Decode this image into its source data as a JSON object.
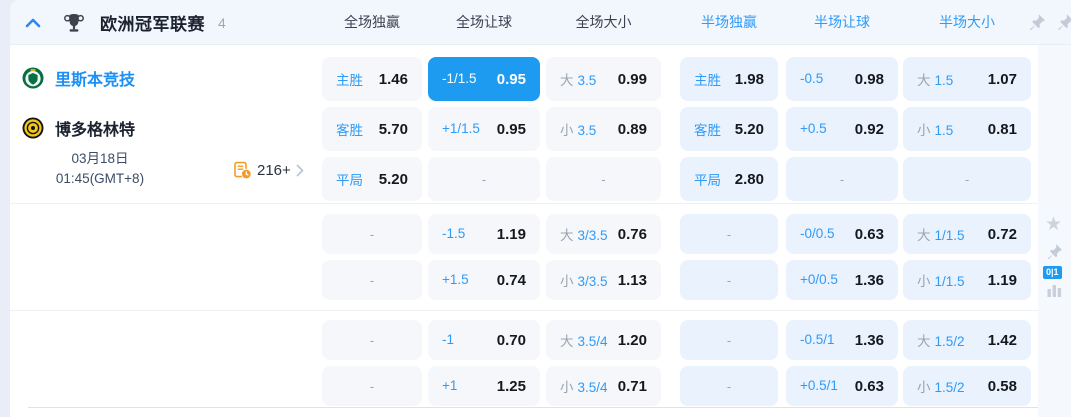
{
  "panel": {
    "league": "欧洲冠军联赛",
    "match_count": "4",
    "columns": [
      {
        "label": "全场独赢",
        "scope": "full"
      },
      {
        "label": "全场让球",
        "scope": "full"
      },
      {
        "label": "全场大小",
        "scope": "full"
      },
      {
        "label": "半场独赢",
        "scope": "half"
      },
      {
        "label": "半场让球",
        "scope": "half"
      },
      {
        "label": "半场大小",
        "scope": "half"
      }
    ]
  },
  "match": {
    "home_team": "里斯本竞技",
    "away_team": "博多格林特",
    "date": "03月18日",
    "time": "01:45(GMT+8)",
    "more_markets": "216+"
  },
  "odds_sections": [
    {
      "rows": [
        {
          "cells": [
            {
              "label": "主胜",
              "value": "1.46"
            },
            {
              "label": "-1/1.5",
              "value": "0.95",
              "selected": true
            },
            {
              "prefix": "大",
              "label": "3.5",
              "value": "0.99"
            },
            {
              "label": "主胜",
              "value": "1.98"
            },
            {
              "label": "-0.5",
              "value": "0.98"
            },
            {
              "prefix": "大",
              "label": "1.5",
              "value": "1.07"
            }
          ]
        },
        {
          "cells": [
            {
              "label": "客胜",
              "value": "5.70"
            },
            {
              "label": "+1/1.5",
              "value": "0.95"
            },
            {
              "prefix": "小",
              "label": "3.5",
              "value": "0.89"
            },
            {
              "label": "客胜",
              "value": "5.20"
            },
            {
              "label": "+0.5",
              "value": "0.92"
            },
            {
              "prefix": "小",
              "label": "1.5",
              "value": "0.81"
            }
          ]
        },
        {
          "cells": [
            {
              "label": "平局",
              "value": "5.20"
            },
            {
              "dash": "-"
            },
            {
              "dash": "-"
            },
            {
              "label": "平局",
              "value": "2.80"
            },
            {
              "dash": "-"
            },
            {
              "dash": "-"
            }
          ]
        }
      ]
    },
    {
      "rows": [
        {
          "cells": [
            {
              "dash": "-"
            },
            {
              "label": "-1.5",
              "value": "1.19"
            },
            {
              "prefix": "大",
              "label": "3/3.5",
              "value": "0.76"
            },
            {
              "dash": "-"
            },
            {
              "label": "-0/0.5",
              "value": "0.63"
            },
            {
              "prefix": "大",
              "label": "1/1.5",
              "value": "0.72"
            }
          ]
        },
        {
          "cells": [
            {
              "dash": "-"
            },
            {
              "label": "+1.5",
              "value": "0.74"
            },
            {
              "prefix": "小",
              "label": "3/3.5",
              "value": "1.13"
            },
            {
              "dash": "-"
            },
            {
              "label": "+0/0.5",
              "value": "1.36"
            },
            {
              "prefix": "小",
              "label": "1/1.5",
              "value": "1.19"
            }
          ]
        }
      ]
    },
    {
      "rows": [
        {
          "cells": [
            {
              "dash": "-"
            },
            {
              "label": "-1",
              "value": "0.70"
            },
            {
              "prefix": "大",
              "label": "3.5/4",
              "value": "1.20"
            },
            {
              "dash": "-"
            },
            {
              "label": "-0.5/1",
              "value": "1.36"
            },
            {
              "prefix": "大",
              "label": "1.5/2",
              "value": "1.42"
            }
          ]
        },
        {
          "cells": [
            {
              "dash": "-"
            },
            {
              "label": "+1",
              "value": "1.25"
            },
            {
              "prefix": "小",
              "label": "3.5/4",
              "value": "0.71"
            },
            {
              "dash": "-"
            },
            {
              "label": "+0.5/1",
              "value": "0.63"
            },
            {
              "prefix": "小",
              "label": "1.5/2",
              "value": "0.58"
            }
          ]
        }
      ]
    }
  ],
  "right_rail": {
    "badge": "0|1"
  },
  "colors": {
    "selected_cell": "#1d9bf0",
    "label_blue": "#2f9bf7",
    "half_cell_bg": "#e9f2fd",
    "full_cell_bg": "#f5f7fa",
    "header_bg": "#f2f6fd",
    "more_icon_orange": "#f59b25"
  }
}
